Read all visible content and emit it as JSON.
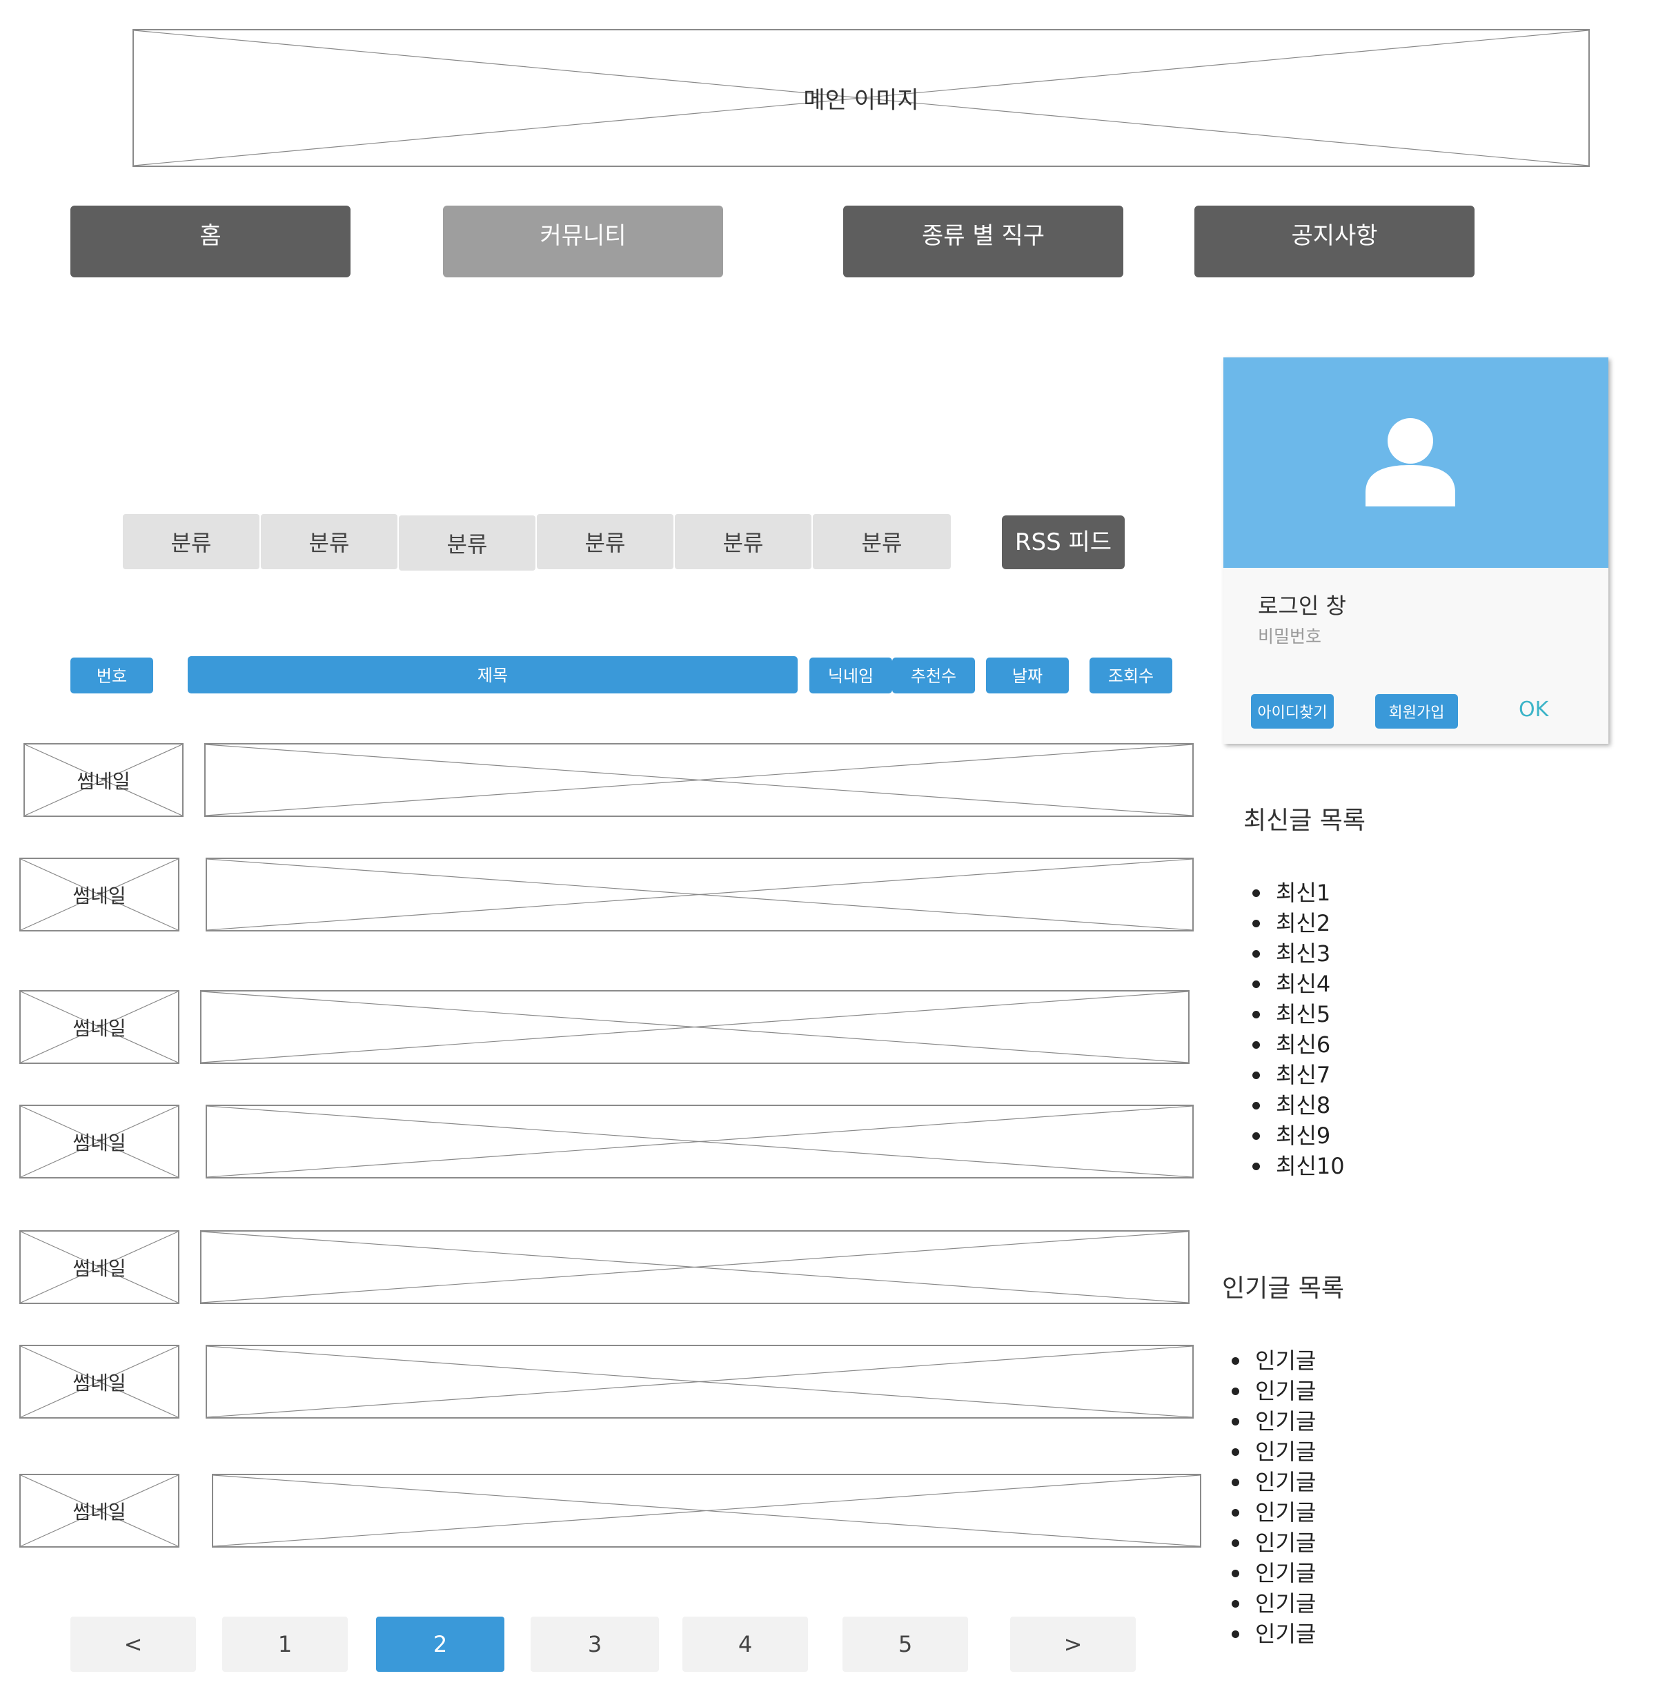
{
  "banner": {
    "label": "메인 이미지"
  },
  "nav": [
    {
      "label": "홈",
      "active": false
    },
    {
      "label": "커뮤니티",
      "active": true
    },
    {
      "label": "종류 별 직구",
      "active": false
    },
    {
      "label": "공지사항",
      "active": false
    }
  ],
  "categories": [
    "분류",
    "분류",
    "분류",
    "분류",
    "분류",
    "분류"
  ],
  "rss_label": "RSS 피드",
  "table_headers": {
    "number": "번호",
    "title": "제목",
    "nickname": "닉네임",
    "recommend": "추천수",
    "date": "날짜",
    "views": "조회수"
  },
  "rows": [
    {
      "thumb": "썸네일"
    },
    {
      "thumb": "썸네일"
    },
    {
      "thumb": "썸네일"
    },
    {
      "thumb": "썸네일"
    },
    {
      "thumb": "썸네일"
    },
    {
      "thumb": "썸네일"
    },
    {
      "thumb": "썸네일"
    }
  ],
  "pagination": {
    "prev": "<",
    "pages": [
      "1",
      "2",
      "3",
      "4",
      "5"
    ],
    "current": "2",
    "next": ">"
  },
  "login": {
    "title": "로그인 창",
    "subtitle": "비밀번호",
    "find_id": "아이디찾기",
    "signup": "회원가입",
    "ok": "OK",
    "header_color": "#6cb8ea",
    "ok_color": "#3cb4c8"
  },
  "recent": {
    "title": "최신글 목록",
    "items": [
      "최신1",
      "최신2",
      "최신3",
      "최신4",
      "최신5",
      "최신6",
      "최신7",
      "최신8",
      "최신9",
      "최신10"
    ]
  },
  "popular": {
    "title": "인기글 목록",
    "items": [
      "인기글",
      "인기글",
      "인기글",
      "인기글",
      "인기글",
      "인기글",
      "인기글",
      "인기글",
      "인기글",
      "인기글"
    ]
  },
  "colors": {
    "accent": "#3a99d9",
    "nav_dark": "#5e5e5e",
    "nav_active": "#9e9e9e"
  }
}
